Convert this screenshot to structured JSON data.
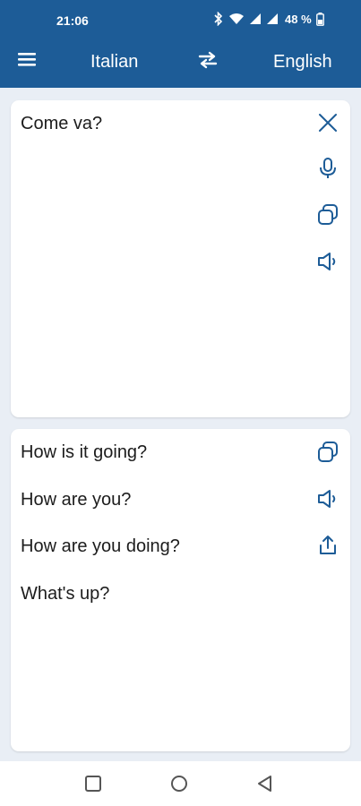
{
  "status_bar": {
    "time": "21:06",
    "battery": "48 %"
  },
  "app_bar": {
    "source_language": "Italian",
    "target_language": "English",
    "background_color": "#1d5c97"
  },
  "input": {
    "text": "Come va?"
  },
  "output": {
    "translations": [
      "How is it going?",
      "How are you?",
      "How are you doing?",
      "What's up?"
    ]
  },
  "icons": {
    "menu": "menu-icon",
    "swap": "swap-icon",
    "clear": "close-icon",
    "mic": "microphone-icon",
    "copy": "copy-icon",
    "speak": "speaker-icon",
    "share": "share-icon"
  },
  "colors": {
    "accent": "#1d5c97",
    "background": "#e9eef5",
    "card": "#ffffff",
    "text": "#1c1c1c"
  }
}
